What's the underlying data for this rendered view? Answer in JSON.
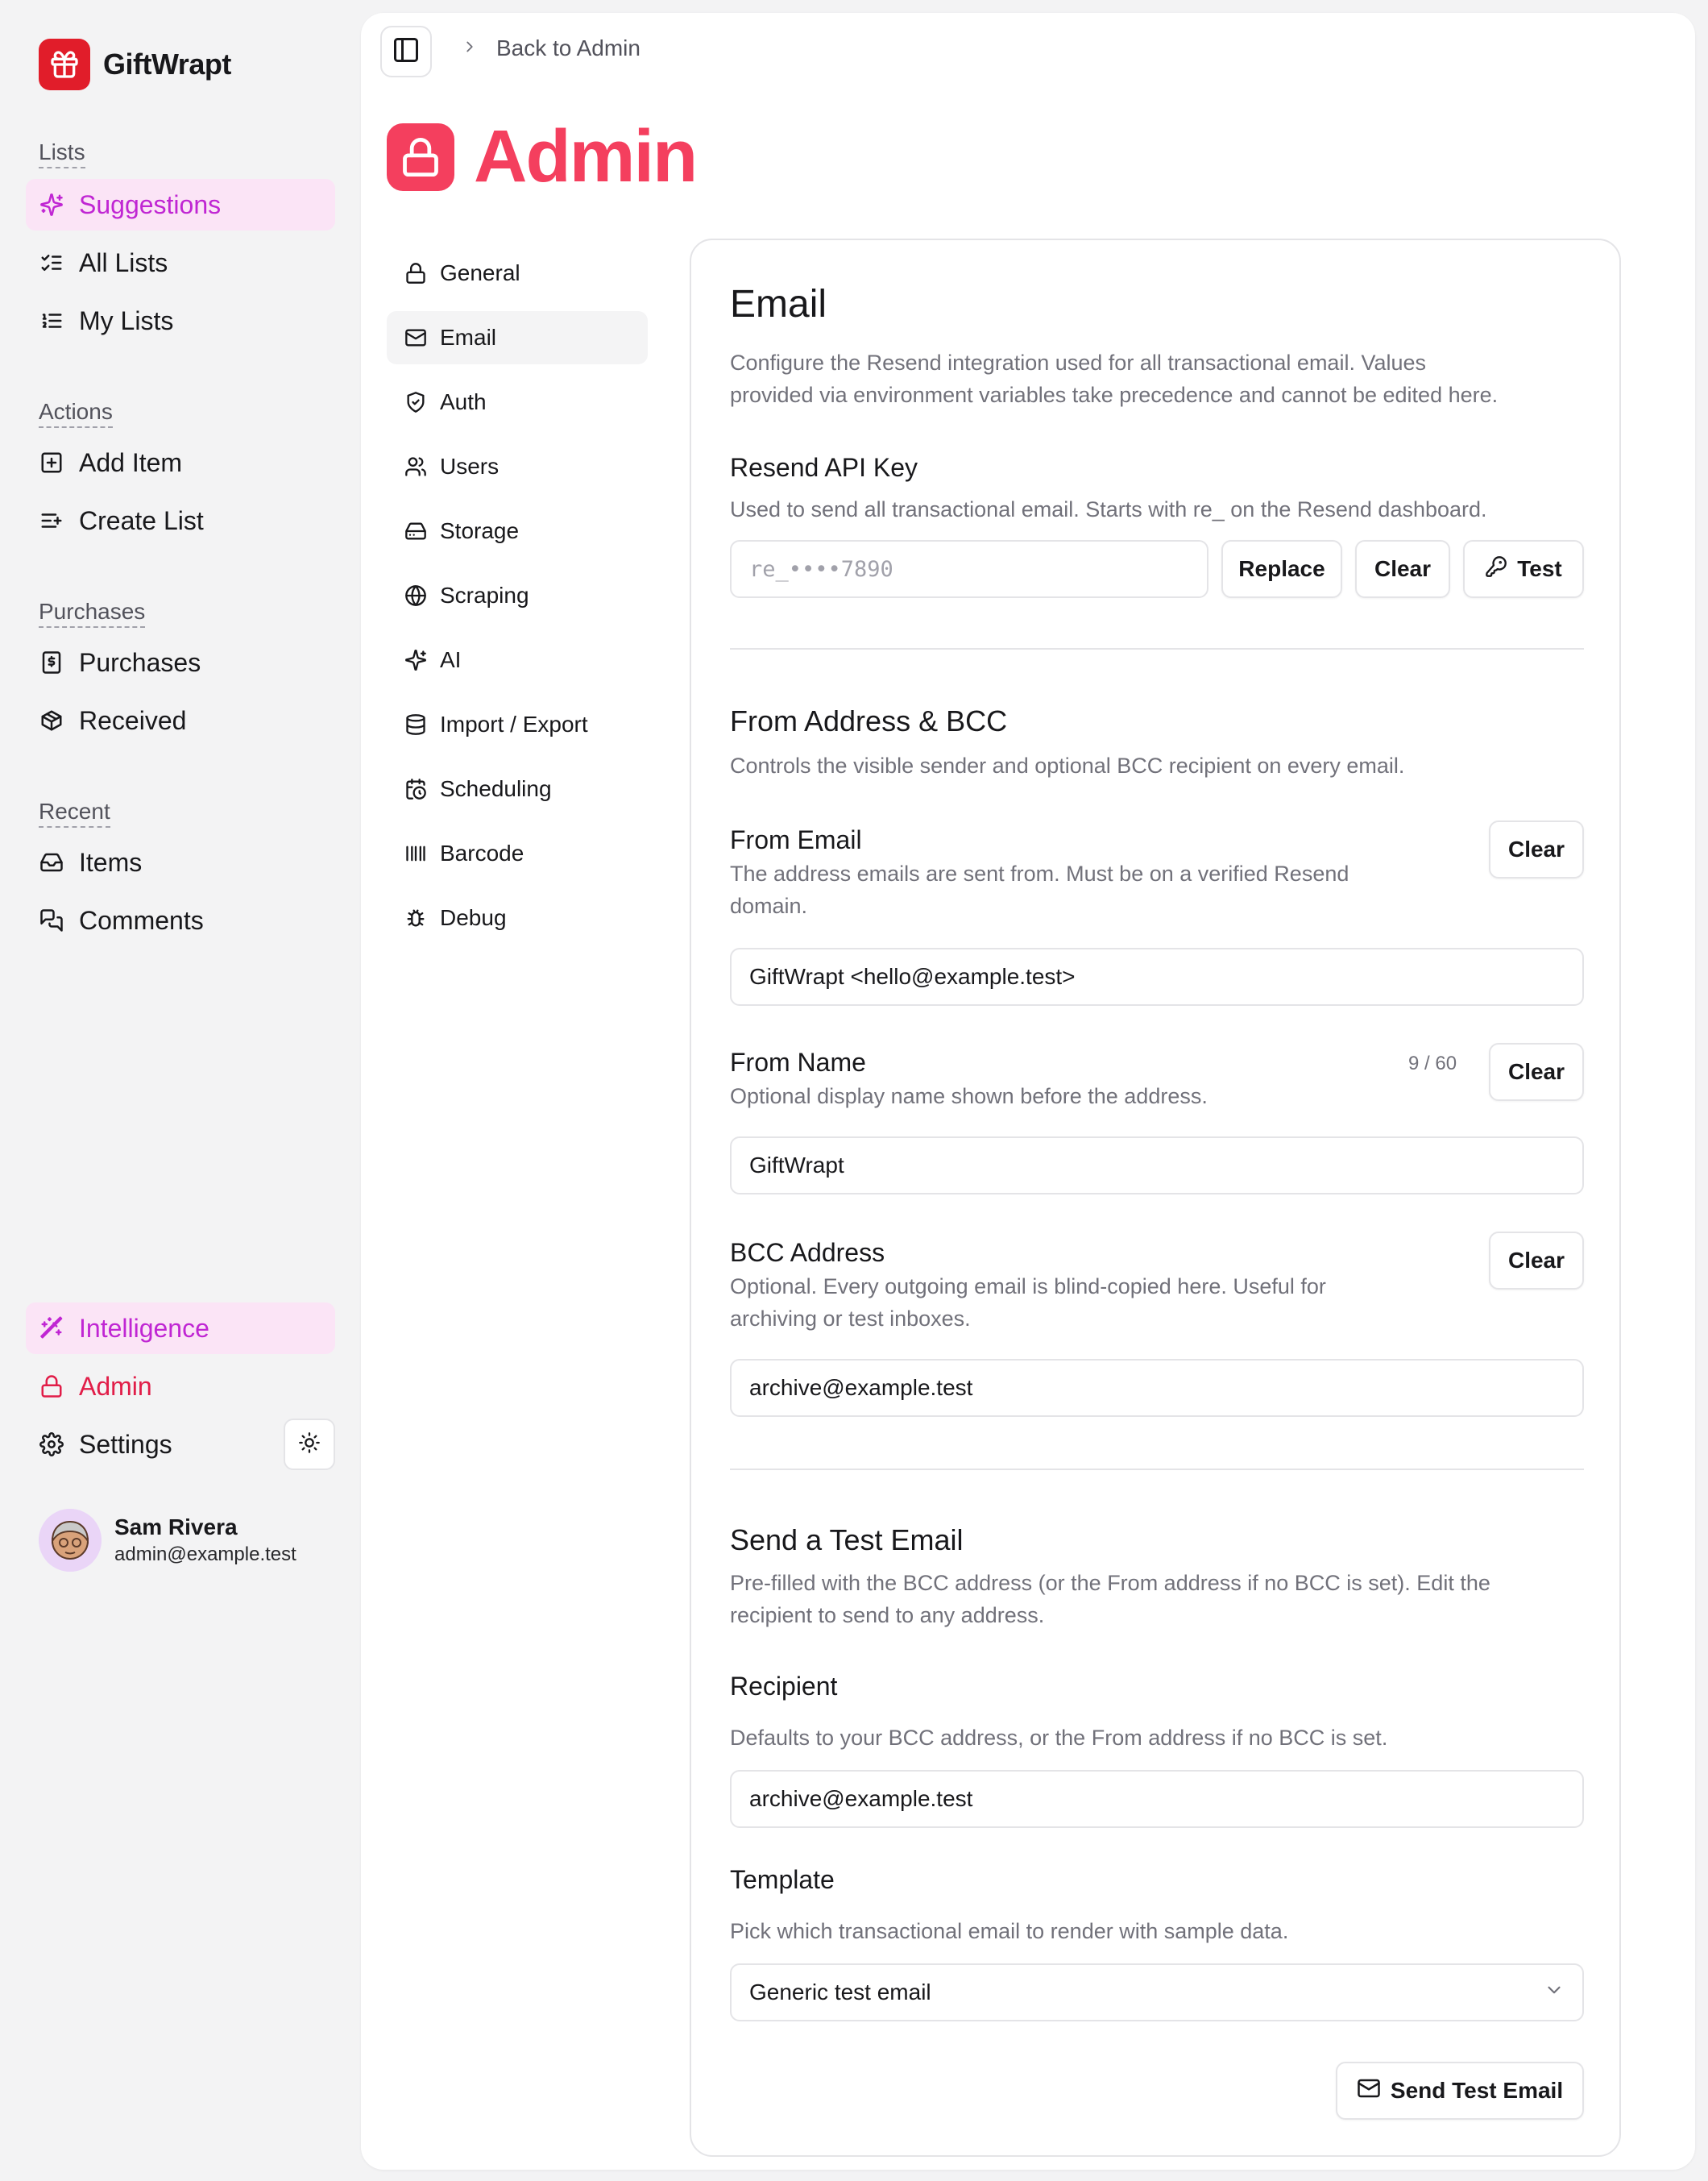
{
  "colors": {
    "brand": "#e11d2a",
    "accent_pink": "#c026d3",
    "admin_red": "#f43f5e"
  },
  "app": {
    "name": "GiftWrapt"
  },
  "sidebar": {
    "sections": [
      {
        "label": "Lists",
        "items": [
          {
            "label": "Suggestions",
            "icon": "sparkles-icon",
            "active": true
          },
          {
            "label": "All Lists",
            "icon": "list-checks-icon"
          },
          {
            "label": "My Lists",
            "icon": "list-ordered-icon"
          }
        ]
      },
      {
        "label": "Actions",
        "items": [
          {
            "label": "Add Item",
            "icon": "square-plus-icon"
          },
          {
            "label": "Create List",
            "icon": "list-plus-icon"
          }
        ]
      },
      {
        "label": "Purchases",
        "items": [
          {
            "label": "Purchases",
            "icon": "receipt-icon"
          },
          {
            "label": "Received",
            "icon": "package-icon"
          }
        ]
      },
      {
        "label": "Recent",
        "items": [
          {
            "label": "Items",
            "icon": "inbox-icon"
          },
          {
            "label": "Comments",
            "icon": "messages-icon"
          }
        ]
      }
    ],
    "bottom": [
      {
        "label": "Intelligence",
        "icon": "wand-icon"
      },
      {
        "label": "Admin",
        "icon": "lock-icon"
      },
      {
        "label": "Settings",
        "icon": "gear-icon"
      }
    ],
    "user": {
      "name": "Sam Rivera",
      "email": "admin@example.test"
    }
  },
  "header": {
    "breadcrumb": "Back to Admin",
    "title": "Admin"
  },
  "subnav": [
    {
      "label": "General",
      "icon": "lock-icon"
    },
    {
      "label": "Email",
      "icon": "mail-icon",
      "active": true
    },
    {
      "label": "Auth",
      "icon": "shield-icon"
    },
    {
      "label": "Users",
      "icon": "users-icon"
    },
    {
      "label": "Storage",
      "icon": "hard-drive-icon"
    },
    {
      "label": "Scraping",
      "icon": "globe-icon"
    },
    {
      "label": "AI",
      "icon": "sparkles-icon"
    },
    {
      "label": "Import / Export",
      "icon": "database-icon"
    },
    {
      "label": "Scheduling",
      "icon": "calendar-clock-icon"
    },
    {
      "label": "Barcode",
      "icon": "barcode-icon"
    },
    {
      "label": "Debug",
      "icon": "bug-icon"
    }
  ],
  "email": {
    "title": "Email",
    "description_1": "Configure the Resend integration used for all transactional email. Values",
    "description_2": "provided via environment variables take precedence and cannot be edited here.",
    "api_key": {
      "label": "Resend API Key",
      "help": "Used to send all transactional email. Starts with re_ on the Resend dashboard.",
      "placeholder": "re_••••7890",
      "replace": "Replace",
      "clear": "Clear",
      "test": "Test"
    },
    "from_bcc": {
      "title": "From Address & BCC",
      "description": "Controls the visible sender and optional BCC recipient on every email."
    },
    "from_email": {
      "label": "From Email",
      "help_1": "The address emails are sent from. Must be on a verified Resend",
      "help_2": "domain.",
      "value": "GiftWrapt <hello@example.test>",
      "clear": "Clear"
    },
    "from_name": {
      "label": "From Name",
      "help": "Optional display name shown before the address.",
      "counter": "9 / 60",
      "value": "GiftWrapt",
      "clear": "Clear"
    },
    "bcc": {
      "label": "BCC Address",
      "help_1": "Optional. Every outgoing email is blind-copied here. Useful for",
      "help_2": "archiving or test inboxes.",
      "value": "archive@example.test",
      "clear": "Clear"
    },
    "test_email": {
      "title": "Send a Test Email",
      "description_1": "Pre-filled with the BCC address (or the From address if no BCC is set). Edit the",
      "description_2": "recipient to send to any address.",
      "recipient_label": "Recipient",
      "recipient_help": "Defaults to your BCC address, or the From address if no BCC is set.",
      "recipient_value": "archive@example.test",
      "template_label": "Template",
      "template_help": "Pick which transactional email to render with sample data.",
      "template_value": "Generic test email",
      "send": "Send Test Email"
    }
  }
}
